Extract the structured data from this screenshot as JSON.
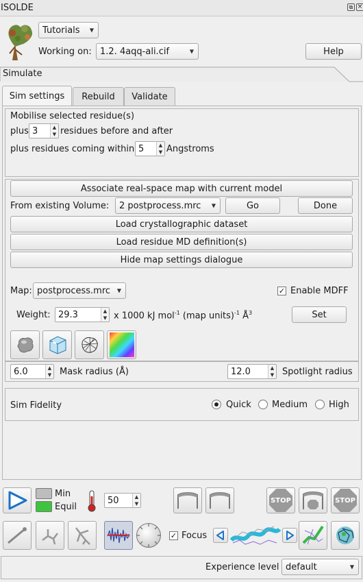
{
  "window": {
    "title": "ISOLDE"
  },
  "header": {
    "tutorials_label": "Tutorials",
    "working_on_label": "Working on:",
    "model": "1.2. 4aqq-ali.cif",
    "help_label": "Help"
  },
  "section_title": "Simulate",
  "tabs": [
    "Sim settings",
    "Rebuild",
    "Validate"
  ],
  "mobilise": {
    "title": "Mobilise selected residue(s)",
    "plus_label": "plus",
    "residues_value": "3",
    "residues_suffix": "residues before and after",
    "within_label": "plus residues coming within",
    "within_value": "5",
    "within_suffix": "Angstroms"
  },
  "maps": {
    "associate_label": "Associate real-space map with current model",
    "from_existing_label": "From existing Volume:",
    "volume_value": "2  postprocess.mrc",
    "go_label": "Go",
    "done_label": "Done",
    "load_crystal_label": "Load crystallographic dataset",
    "load_residue_label": "Load residue MD definition(s)",
    "hide_label": "Hide map settings dialogue",
    "map_label": "Map:",
    "map_value": "postprocess.mrc",
    "enable_mdff_label": "Enable MDFF",
    "weight_label": "Weight:",
    "weight_value": "29.3",
    "weight_units": "x 1000 kJ mol",
    "weight_sup1": "-1",
    "weight_units2": " (map units)",
    "weight_sup2": "-1",
    "weight_units3": " Å",
    "weight_sup3": "3",
    "set_label": "Set"
  },
  "mask": {
    "mask_value": "6.0",
    "mask_label": "Mask radius (Å)",
    "spotlight_value": "12.0",
    "spotlight_label": "Spotlight radius"
  },
  "fidelity": {
    "title": "Sim Fidelity",
    "options": [
      "Quick",
      "Medium",
      "High"
    ],
    "selected": "Quick"
  },
  "toolbar": {
    "min_label": "Min",
    "equil_label": "Equil",
    "temperature_value": "50",
    "stop_label": "STOP",
    "focus_label": "Focus"
  },
  "footer": {
    "experience_label": "Experience level",
    "experience_value": "default"
  },
  "colors": {
    "equil_active": "#3ec43e",
    "play_accent": "#1a73c8"
  }
}
